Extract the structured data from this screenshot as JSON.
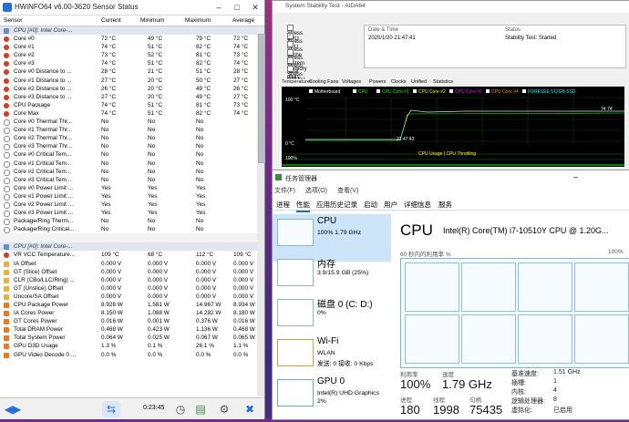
{
  "hwinfo": {
    "title": "HWiNFO64 v6.00-3620 Sensor Status",
    "columns": [
      "Sensor",
      "Current",
      "Minimum",
      "Maximum",
      "Average"
    ],
    "group1": "CPU [#0]: Intel Core-...",
    "rows1": [
      {
        "name": "Core #0",
        "cur": "72 °C",
        "min": "49 °C",
        "max": "79 °C",
        "avg": "72 °C",
        "icon": "temp"
      },
      {
        "name": "Core #1",
        "cur": "74 °C",
        "min": "51 °C",
        "max": "82 °C",
        "avg": "74 °C",
        "icon": "temp"
      },
      {
        "name": "Core #2",
        "cur": "73 °C",
        "min": "52 °C",
        "max": "81 °C",
        "avg": "73 °C",
        "icon": "temp"
      },
      {
        "name": "Core #3",
        "cur": "74 °C",
        "min": "51 °C",
        "max": "82 °C",
        "avg": "74 °C",
        "icon": "temp"
      },
      {
        "name": "Core #0 Distance to ...",
        "cur": "28 °C",
        "min": "21 °C",
        "max": "51 °C",
        "avg": "28 °C",
        "icon": "temp"
      },
      {
        "name": "Core #1 Distance to ...",
        "cur": "27 °C",
        "min": "20 °C",
        "max": "50 °C",
        "avg": "27 °C",
        "icon": "temp"
      },
      {
        "name": "Core #2 Distance to ...",
        "cur": "26 °C",
        "min": "20 °C",
        "max": "49 °C",
        "avg": "26 °C",
        "icon": "temp"
      },
      {
        "name": "Core #3 Distance to ...",
        "cur": "27 °C",
        "min": "20 °C",
        "max": "49 °C",
        "avg": "27 °C",
        "icon": "temp"
      },
      {
        "name": "CPU Package",
        "cur": "74 °C",
        "min": "51 °C",
        "max": "81 °C",
        "avg": "73 °C",
        "icon": "temp"
      },
      {
        "name": "Core Max",
        "cur": "74 °C",
        "min": "51 °C",
        "max": "82 °C",
        "avg": "74 °C",
        "icon": "temp"
      },
      {
        "name": "Core #0 Thermal Thr...",
        "cur": "No",
        "min": "No",
        "max": "No",
        "avg": "",
        "icon": "thr"
      },
      {
        "name": "Core #1 Thermal Thr...",
        "cur": "No",
        "min": "No",
        "max": "No",
        "avg": "",
        "icon": "thr"
      },
      {
        "name": "Core #2 Thermal Thr...",
        "cur": "No",
        "min": "No",
        "max": "No",
        "avg": "",
        "icon": "thr"
      },
      {
        "name": "Core #3 Thermal Thr...",
        "cur": "No",
        "min": "No",
        "max": "No",
        "avg": "",
        "icon": "thr"
      },
      {
        "name": "Core #0 Critical Tem...",
        "cur": "No",
        "min": "No",
        "max": "No",
        "avg": "",
        "icon": "thr"
      },
      {
        "name": "Core #1 Critical Tem...",
        "cur": "No",
        "min": "No",
        "max": "No",
        "avg": "",
        "icon": "thr"
      },
      {
        "name": "Core #2 Critical Tem...",
        "cur": "No",
        "min": "No",
        "max": "No",
        "avg": "",
        "icon": "thr"
      },
      {
        "name": "Core #3 Critical Tem...",
        "cur": "No",
        "min": "No",
        "max": "No",
        "avg": "",
        "icon": "thr"
      },
      {
        "name": "Core #0 Power Limit ...",
        "cur": "Yes",
        "min": "Yes",
        "max": "Yes",
        "avg": "",
        "icon": "thr"
      },
      {
        "name": "Core #1 Power Limit ...",
        "cur": "Yes",
        "min": "Yes",
        "max": "Yes",
        "avg": "",
        "icon": "thr"
      },
      {
        "name": "Core #2 Power Limit ...",
        "cur": "Yes",
        "min": "Yes",
        "max": "Yes",
        "avg": "",
        "icon": "thr"
      },
      {
        "name": "Core #3 Power Limit ...",
        "cur": "Yes",
        "min": "Yes",
        "max": "Yes",
        "avg": "",
        "icon": "thr"
      },
      {
        "name": "Package/Ring Therm...",
        "cur": "No",
        "min": "No",
        "max": "No",
        "avg": "",
        "icon": "thr"
      },
      {
        "name": "Package/Ring Critical...",
        "cur": "No",
        "min": "No",
        "max": "No",
        "avg": "",
        "icon": "thr"
      }
    ],
    "group2": "CPU [#0]: Intel Core-...",
    "rows2": [
      {
        "name": "VR VCC Temperature...",
        "cur": "109 °C",
        "min": "68 °C",
        "max": "112 °C",
        "avg": "109 °C",
        "icon": "temp"
      },
      {
        "name": "IA Offset",
        "cur": "0.000 V",
        "min": "0.000 V",
        "max": "0.000 V",
        "avg": "0.000 V",
        "icon": "volt"
      },
      {
        "name": "GT (Slice) Offset",
        "cur": "0.000 V",
        "min": "0.000 V",
        "max": "0.000 V",
        "avg": "0.000 V",
        "icon": "volt"
      },
      {
        "name": "CLR (CBo/LLC/Ring) ...",
        "cur": "0.000 V",
        "min": "0.000 V",
        "max": "0.000 V",
        "avg": "0.000 V",
        "icon": "volt"
      },
      {
        "name": "GT (Unslice) Offset",
        "cur": "0.000 V",
        "min": "0.000 V",
        "max": "0.000 V",
        "avg": "0.000 V",
        "icon": "volt"
      },
      {
        "name": "Uncore/SA Offset",
        "cur": "0.000 V",
        "min": "0.000 V",
        "max": "0.000 V",
        "avg": "0.000 V",
        "icon": "volt"
      },
      {
        "name": "CPU Package Power",
        "cur": "8.928 W",
        "min": "1.581 W",
        "max": "14.967 W",
        "avg": "8.934 W",
        "icon": "pow"
      },
      {
        "name": "IA Cores Power",
        "cur": "8.150 W",
        "min": "1.088 W",
        "max": "14.282 W",
        "avg": "8.180 W",
        "icon": "pow"
      },
      {
        "name": "GT Cores Power",
        "cur": "0.016 W",
        "min": "0.001 W",
        "max": "0.376 W",
        "avg": "0.016 W",
        "icon": "pow"
      },
      {
        "name": "Total DRAM Power",
        "cur": "0.468 W",
        "min": "0.423 W",
        "max": "1.136 W",
        "avg": "0.468 W",
        "icon": "pow"
      },
      {
        "name": "Total System Power",
        "cur": "0.064 W",
        "min": "0.025 W",
        "max": "0.067 W",
        "avg": "0.065 W",
        "icon": "pow"
      },
      {
        "name": "GPU D3D Usage",
        "cur": "1.3 %",
        "min": "0.1 %",
        "max": "26.1 %",
        "avg": "1.1 %",
        "icon": "pow"
      },
      {
        "name": "GPU Video Decode 0 ...",
        "cur": "0.0 %",
        "min": "0.0 %",
        "max": "0.0 %",
        "avg": "0.0 %",
        "icon": "pow"
      }
    ],
    "timer": "0:23:45"
  },
  "sst": {
    "title": "System Stability Test - AIDA64",
    "checks": [
      {
        "label": "Stress CPU",
        "checked": false
      },
      {
        "label": "Stress FPU",
        "checked": true
      },
      {
        "label": "Stress cache",
        "checked": false
      },
      {
        "label": "Stress system memory",
        "checked": false
      },
      {
        "label": "Stress local disks",
        "checked": false
      },
      {
        "label": "Stress GPU(s)",
        "checked": false
      }
    ],
    "info_head": [
      "Date & Time",
      "Status"
    ],
    "info_vals": [
      "2020/1/20 21:47:41",
      "Stability Test: Started"
    ],
    "tabs": [
      "Temperatures",
      "Cooling Fans",
      "Voltages",
      "Powers",
      "Clocks",
      "Unified",
      "Statistics"
    ],
    "legend": [
      "Motherboard",
      "CPU",
      "CPU Core #1",
      "CPU Core #2",
      "CPU Core #3",
      "CPU Core #4",
      "FORESEE 512GB SSD"
    ],
    "legend_colors": [
      "#ffffff",
      "#00ff00",
      "#00ff00",
      "#ffff00",
      "#ff00ff",
      "#ff9900",
      "#00ffff"
    ],
    "axis_top": "100 °C",
    "axis_bottom": "0 °C",
    "readout": "74 74",
    "time_label": "21:47:43",
    "usage_label": "CPU Usage | CPU Throttling",
    "usage_top": "100%"
  },
  "tm": {
    "title": "任务管理器",
    "menu": [
      "文件(F)",
      "选项(O)",
      "查看(V)"
    ],
    "tabs": [
      "进程",
      "性能",
      "应用历史记录",
      "启动",
      "用户",
      "详细信息",
      "服务"
    ],
    "active_tab": 1,
    "resources": [
      {
        "name": "CPU",
        "v1": "100% 1.79 GHz",
        "v2": ""
      },
      {
        "name": "内存",
        "v1": "3.9/15.9 GB (25%)",
        "v2": ""
      },
      {
        "name": "磁盘 0 (C: D:)",
        "v1": "0%",
        "v2": ""
      },
      {
        "name": "Wi-Fi",
        "v1": "WLAN",
        "v2": "发送: 0 接收: 0 Kbps"
      },
      {
        "name": "GPU 0",
        "v1": "Intel(R) UHD Graphics",
        "v2": "2%"
      }
    ],
    "cpu_title": "CPU",
    "cpu_model": "Intel(R) Core(TM) i7-10510Y CPU @ 1.20G...",
    "graph_label": "60 秒内的利用率 %",
    "graph_top": "100%",
    "stats": {
      "util_label": "利用率",
      "util": "100%",
      "speed_label": "速度",
      "speed": "1.79 GHz",
      "proc_label": "进程",
      "proc": "180",
      "thr_label": "线程",
      "thr": "1998",
      "hnd_label": "句柄",
      "hnd": "75435"
    },
    "kv": [
      {
        "k": "基准速度:",
        "v": "1.51 GHz"
      },
      {
        "k": "插槽:",
        "v": "1"
      },
      {
        "k": "内核:",
        "v": "4"
      },
      {
        "k": "逻辑处理器:",
        "v": "8"
      },
      {
        "k": "虚拟化:",
        "v": "已启用"
      }
    ]
  }
}
